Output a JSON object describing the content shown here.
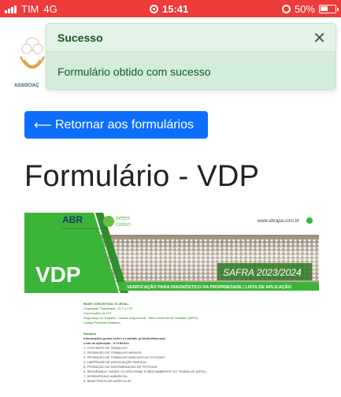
{
  "status_bar": {
    "carrier": "TIM",
    "network": "4G",
    "time": "15:41",
    "battery": "50%",
    "battery_level": 0.5
  },
  "header": {
    "logo_text": "ASSOCIAÇ"
  },
  "toast": {
    "title": "Sucesso",
    "close_symbol": "✕",
    "message": "Formulário obtido com sucesso",
    "bg_color": "#d4edda",
    "text_color": "#155724"
  },
  "back_button": {
    "arrow": "⟵",
    "label": "Retornar aos formulários",
    "color": "#0d6efd"
  },
  "page_title": "Formulário - VDP",
  "document": {
    "abr": "ABR",
    "abr_sub": "ALGODÃO BRASILEIRO RESPONSÁVEL",
    "better": "better",
    "cotton": "cotton",
    "website": "www.abrapa.com.br",
    "vdp": "VDP",
    "safra": "SAFRA 2023/2024",
    "subtitle": "VERIFICAÇÃO PARA DIAGNÓSTICO DA PROPRIEDADE | LISTA DE APLICAÇÃO",
    "base_title": "BASE CONCEITUAL E LEGAL:",
    "base_lines": [
      "Legislação Trabalhista - CLT e LTR",
      "Convenções da OIT",
      "Segurança do Trabalho - Saúde ocupacional - Meio Ambiente de Trabalho (NR31)",
      "Código Florestal Brasileiro"
    ],
    "summary_title": "Sumário",
    "summary_sub": "Informações gerais sobre a unidade produtiva/fazenda",
    "summary_sub2": "Lista de aplicação - 8 Critérios",
    "criteria": [
      "1. CONTRATO DE TRABALHO",
      "2. PROIBIÇÃO DE TRABALHO INFANTIL",
      "3. PROIBIÇÃO DE TRABALHO ANÁLOGO AO ESCRAVO",
      "4. LIBERDADE DE ASSOCIAÇÃO SINDICAL",
      "5. PROIBIÇÃO DE DISCRIMINAÇÃO DE PESSOAS",
      "6. SEGURANÇA, SAÚDE OCUPACIONAL E MEIO AMBIENTE DO TRABALHO (NR31)",
      "7. DESEMPENHO AMBIENTAL",
      "8. BOAS PRÁTICAS AGRÍCOLAS"
    ]
  }
}
